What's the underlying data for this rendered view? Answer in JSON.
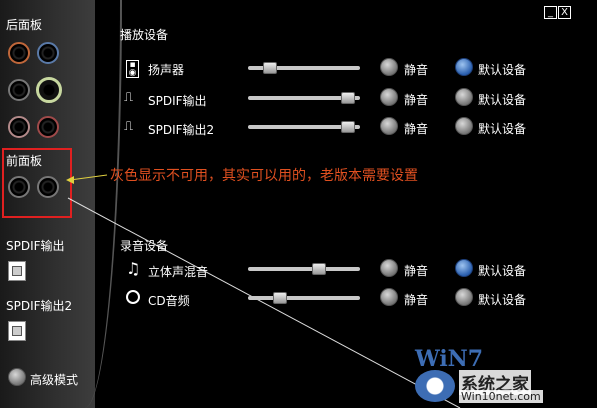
{
  "window_controls": {
    "minimize": "_",
    "close": "X"
  },
  "sidebar": {
    "rear_panel_label": "后面板",
    "front_panel_label": "前面板",
    "spdif_out_label": "SPDIF输出",
    "spdif_out2_label": "SPDIF输出2",
    "advanced_mode_label": "高级模式"
  },
  "annotation": "灰色显示不可用，其实可以用的，老版本需要设置",
  "playback": {
    "title": "播放设备",
    "devices": [
      {
        "name": "扬声器",
        "icon": "speaker-icon",
        "volume": 0.15,
        "mute_label": "静音",
        "default_label": "默认设备",
        "is_default": true
      },
      {
        "name": "SPDIF输出",
        "icon": "digital-wave-icon",
        "volume": 0.95,
        "mute_label": "静音",
        "default_label": "默认设备",
        "is_default": false
      },
      {
        "name": "SPDIF输出2",
        "icon": "digital-wave-icon",
        "volume": 0.95,
        "mute_label": "静音",
        "default_label": "默认设备",
        "is_default": false
      }
    ]
  },
  "recording": {
    "title": "录音设备",
    "devices": [
      {
        "name": "立体声混音",
        "icon": "music-note-icon",
        "volume": 0.65,
        "mute_label": "静音",
        "default_label": "默认设备",
        "is_default": true
      },
      {
        "name": "CD音频",
        "icon": "cd-icon",
        "volume": 0.25,
        "mute_label": "静音",
        "default_label": "默认设备",
        "is_default": false
      }
    ]
  },
  "watermark": {
    "brand": "WiN7",
    "site_name": "系统之家",
    "url": "Win10net.com"
  }
}
